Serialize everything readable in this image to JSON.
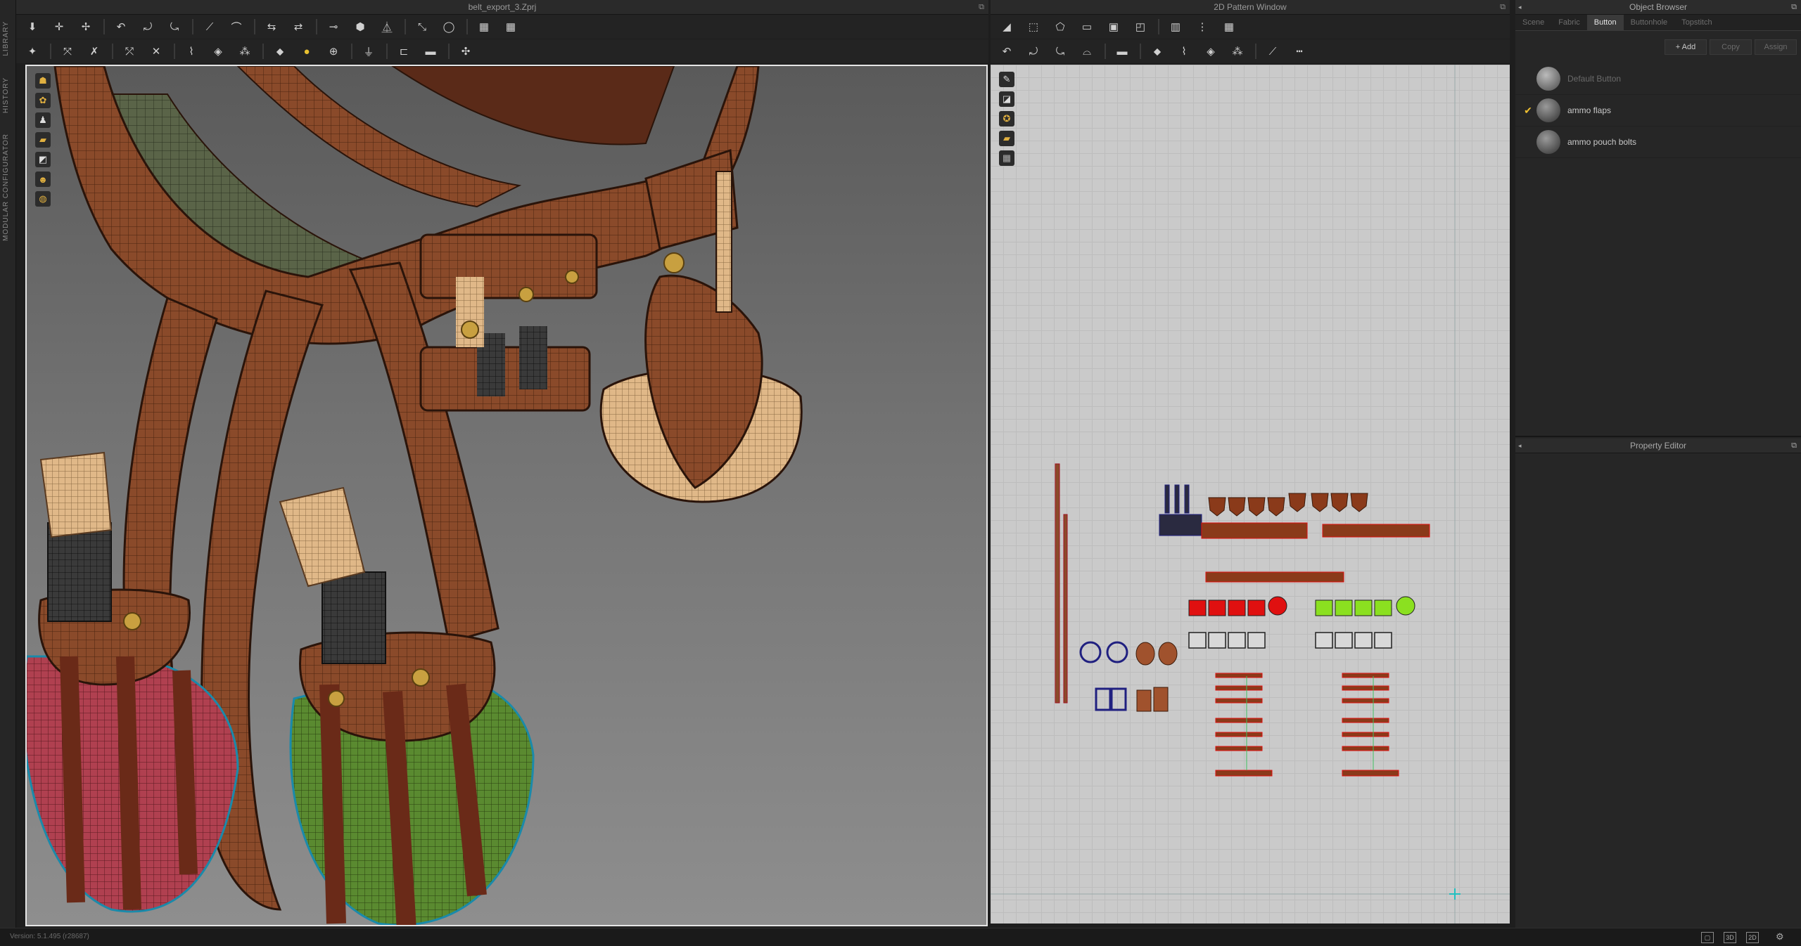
{
  "sidebar_tabs": [
    "LIBRARY",
    "HISTORY",
    "MODULAR CONFIGURATOR"
  ],
  "window_3d": {
    "title": "belt_export_3.Zprj"
  },
  "window_2d": {
    "title": "2D Pattern Window"
  },
  "toolbar_3d_row1": [
    "move-icon",
    "transform-icon",
    "edit-point-icon",
    "undo-seam-icon",
    "fold-icon",
    "pin-icon",
    "line-icon",
    "curve-icon",
    "sewing-icon",
    "free-sewing-icon",
    "tack-icon",
    "button-icon",
    "hanger-icon",
    "zip-icon",
    "grid-icon",
    "trim-icon"
  ],
  "toolbar_3d_row2": [
    "avatar-icon",
    "measure-icon",
    "stitch-icon",
    "puckering-icon",
    "fold-arrange-icon",
    "pleat-icon",
    "seamline-icon",
    "elastic-icon",
    "shrink-icon",
    "topstitch-icon",
    "piping-icon",
    "button-place-icon",
    "buttonhole-icon",
    "zipper-icon",
    "trim-icon",
    "tape-icon"
  ],
  "toolbar_2d_row1": [
    "select-icon",
    "transform-pattern-icon",
    "polygon-icon",
    "rectangle-icon",
    "circle-icon",
    "internal-shape-icon",
    "dart-icon",
    "segment-sewing-icon",
    "grid-icon"
  ],
  "toolbar_2d_row2": [
    "undo-icon",
    "edit-curve-icon",
    "add-point-icon",
    "notch-icon",
    "tape-icon",
    "gluing-icon",
    "symmetric-icon",
    "trace-icon",
    "pattern-icon",
    "measure-icon",
    "ruler-icon"
  ],
  "object_browser": {
    "title": "Object Browser",
    "tabs": [
      "Scene",
      "Fabric",
      "Button",
      "Buttonhole",
      "Topstitch"
    ],
    "active_tab": "Button",
    "actions": [
      "+ Add",
      "Copy",
      "Assign"
    ],
    "items": [
      {
        "label": "Default Button",
        "checked": false,
        "dim": true
      },
      {
        "label": "ammo flaps",
        "checked": true,
        "dim": false
      },
      {
        "label": "ammo pouch bolts",
        "checked": false,
        "dim": false
      }
    ]
  },
  "property_editor": {
    "title": "Property Editor"
  },
  "status": {
    "version": "Version: 5.1.495 (r28687)"
  },
  "colors": {
    "accent": "#f0c030",
    "leather": "#8a4a2a",
    "red": "#e01010",
    "green": "#8be020",
    "blue": "#202080"
  }
}
